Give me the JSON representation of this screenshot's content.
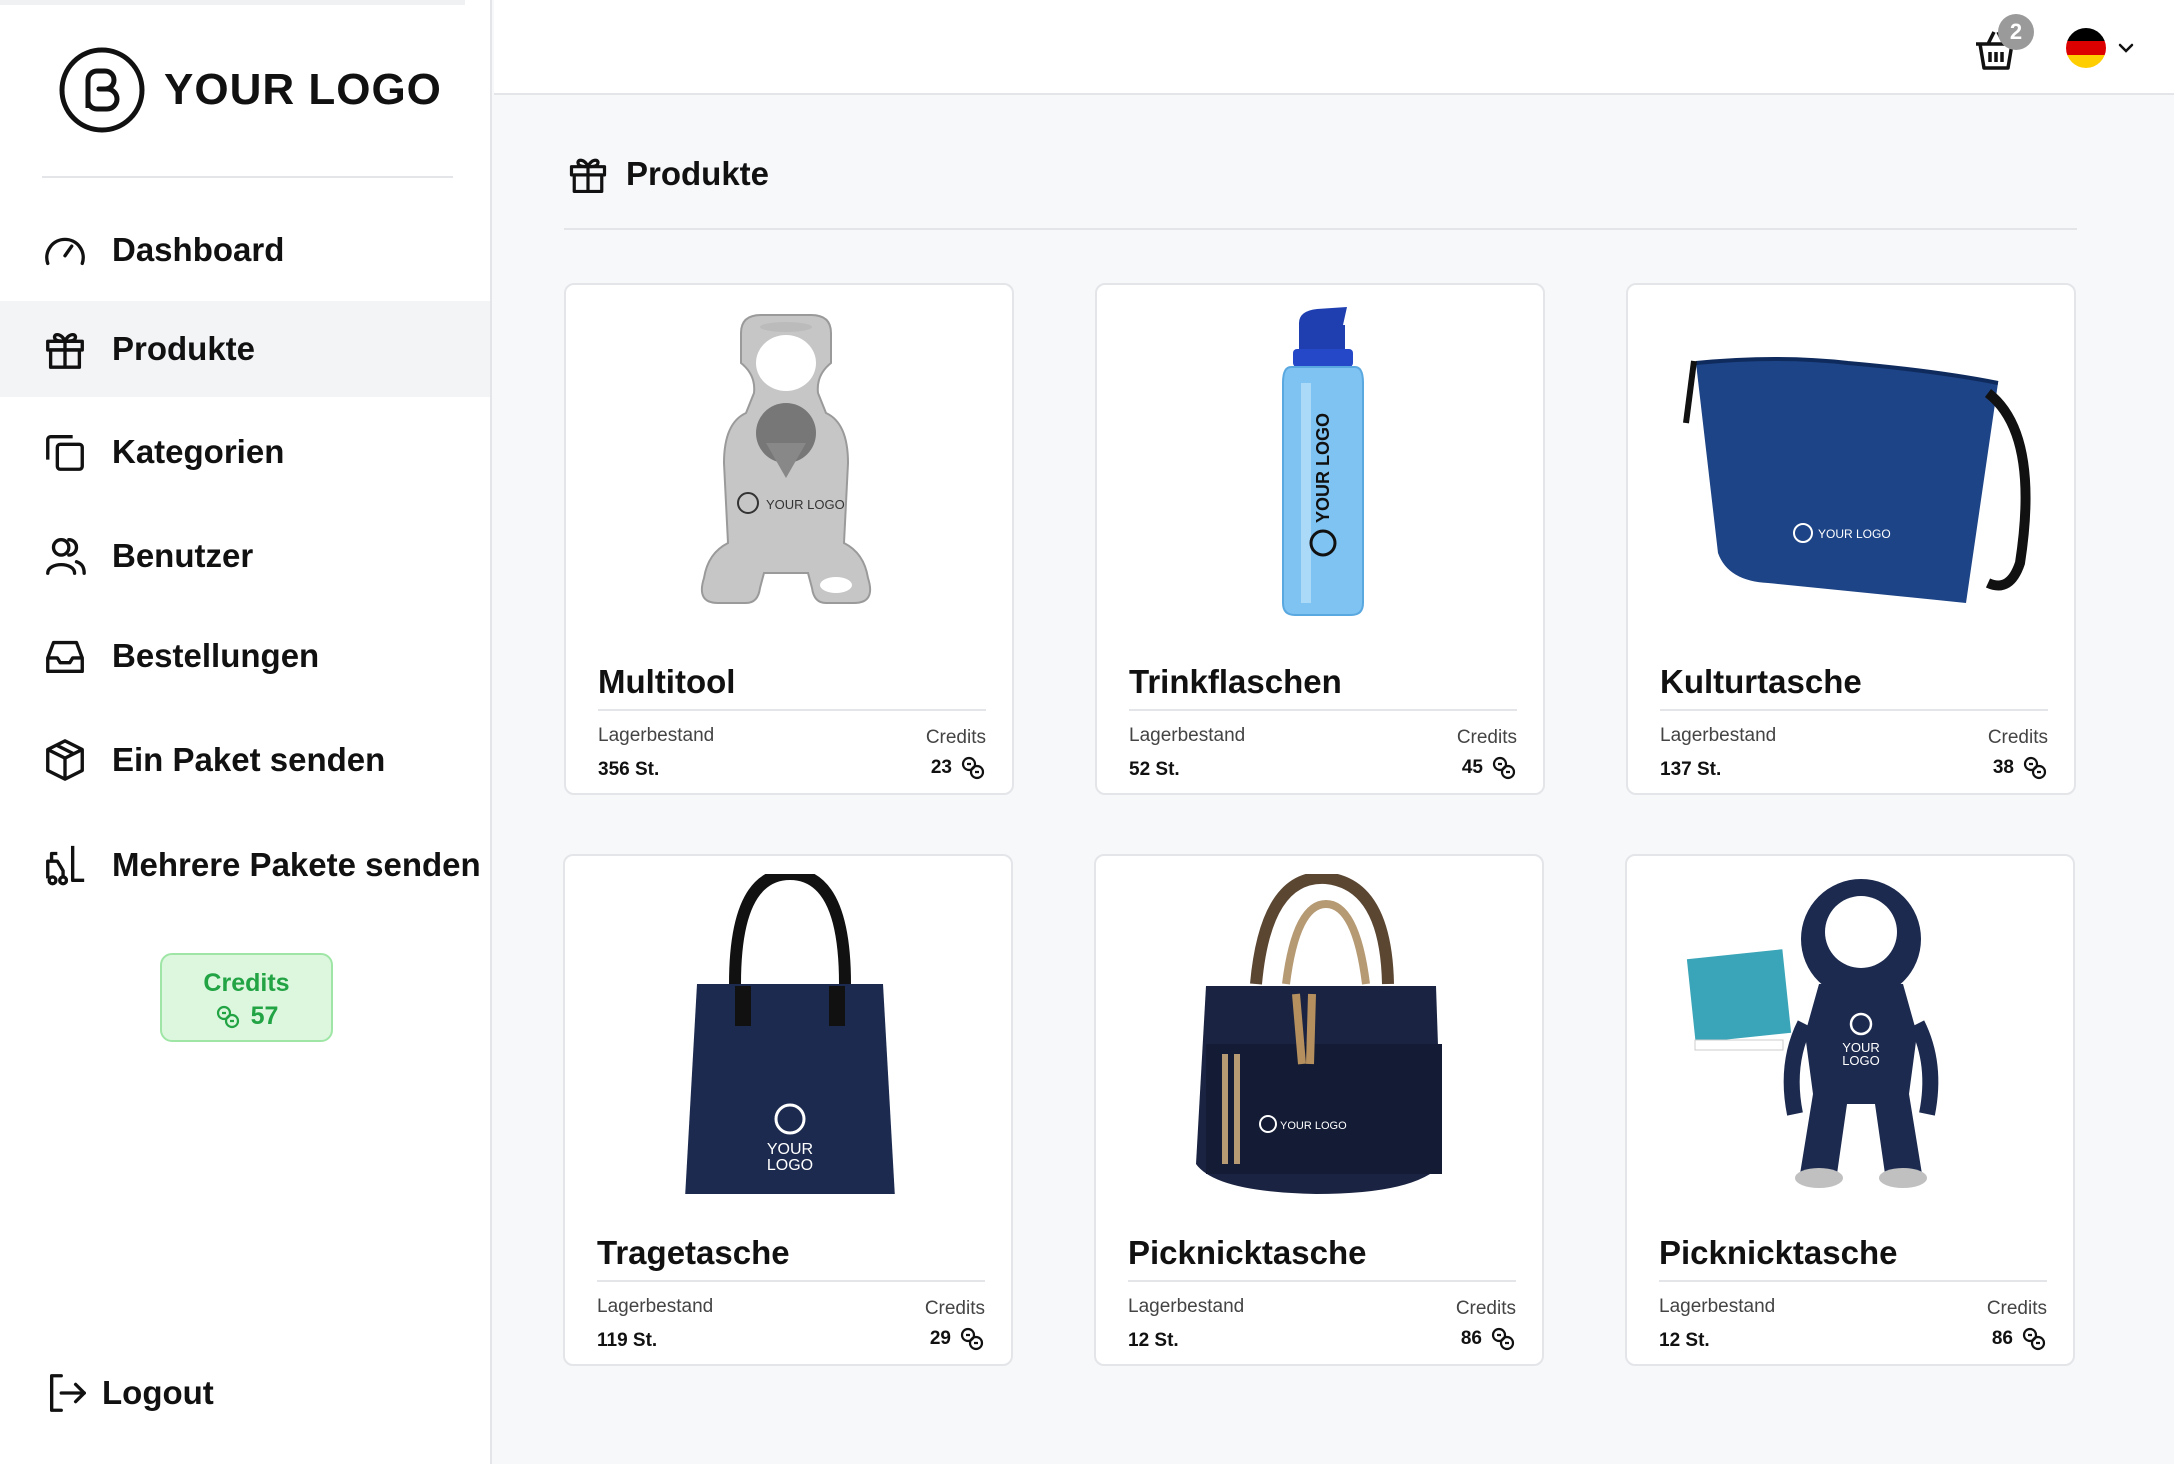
{
  "brand": {
    "logo_text": "YOUR LOGO"
  },
  "sidebar": {
    "items": [
      {
        "label": "Dashboard",
        "icon": "speedometer-icon"
      },
      {
        "label": "Produkte",
        "icon": "gift-icon",
        "active": true
      },
      {
        "label": "Kategorien",
        "icon": "copy-icon"
      },
      {
        "label": "Benutzer",
        "icon": "users-icon"
      },
      {
        "label": "Bestellungen",
        "icon": "inbox-icon"
      },
      {
        "label": "Ein Paket senden",
        "icon": "package-icon"
      },
      {
        "label": "Mehrere Pakete senden",
        "icon": "forklift-icon"
      }
    ],
    "credits": {
      "label": "Credits",
      "value": "57"
    },
    "logout_label": "Logout"
  },
  "topbar": {
    "cart": {
      "icon": "basket-icon",
      "count": "2"
    },
    "language": {
      "icon": "germany-flag-icon",
      "flag_colors": [
        "#000000",
        "#dd0000",
        "#ffce00"
      ]
    }
  },
  "main": {
    "title": "Produkte",
    "stock_label": "Lagerbestand",
    "credits_label": "Credits",
    "products": [
      {
        "name": "Multitool",
        "stock": "356 St.",
        "credits": "23"
      },
      {
        "name": "Trinkflaschen",
        "stock": "52 St.",
        "credits": "45"
      },
      {
        "name": "Kulturtasche",
        "stock": "137 St.",
        "credits": "38"
      },
      {
        "name": "Tragetasche",
        "stock": "119 St.",
        "credits": "29"
      },
      {
        "name": "Picknicktasche",
        "stock": "12 St.",
        "credits": "86"
      },
      {
        "name": "Picknicktasche",
        "stock": "12 St.",
        "credits": "86"
      }
    ]
  },
  "colors": {
    "accent_green": "#22a344",
    "credits_bg": "#dcf7de",
    "navy": "#1c2a4f"
  }
}
